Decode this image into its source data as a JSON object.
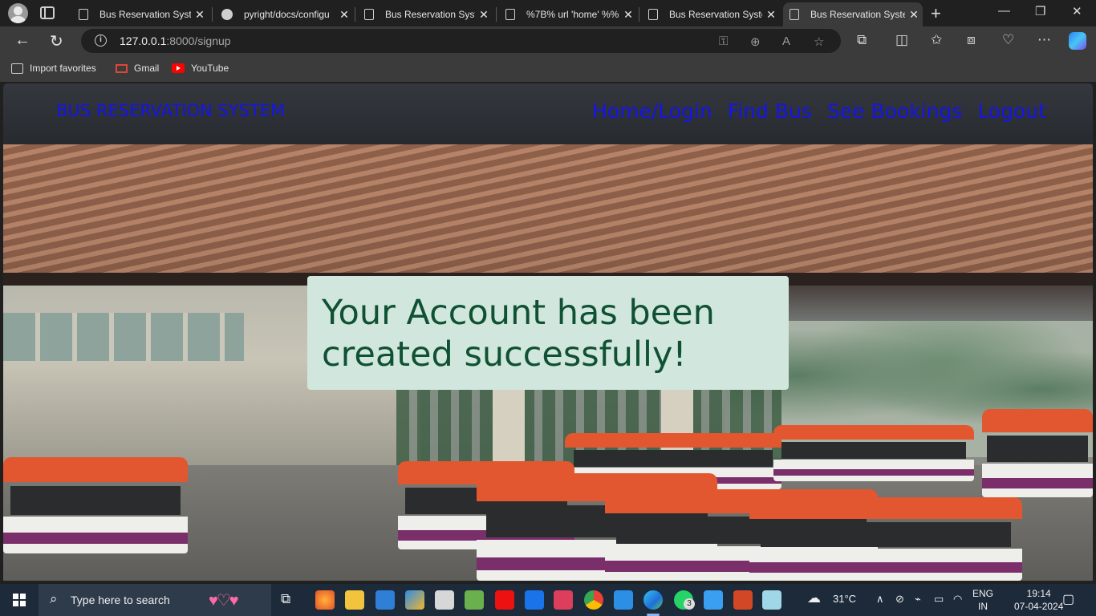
{
  "browser": {
    "tabs": [
      {
        "title": "Bus Reservation Syste",
        "active": false
      },
      {
        "title": "pyright/docs/configu",
        "active": false
      },
      {
        "title": "Bus Reservation Syste",
        "active": false
      },
      {
        "title": "%7B% url 'home' %%",
        "active": false
      },
      {
        "title": "Bus Reservation Syste",
        "active": false
      },
      {
        "title": "Bus Reservation Syste",
        "active": true
      }
    ],
    "close_glyph": "✕",
    "new_tab_glyph": "+",
    "address": {
      "host": "127.0.0.1",
      "rest": ":8000/signup"
    },
    "favorites": [
      {
        "label": "Import favorites",
        "icon": "import-icon"
      },
      {
        "label": "Gmail",
        "icon": "gmail-icon"
      },
      {
        "label": "YouTube",
        "icon": "youtube-icon"
      }
    ]
  },
  "site": {
    "brand": "BUS RESERVATION SYSTEM",
    "nav": [
      "Home/Login",
      "Find Bus",
      "See Bookings",
      "Logout"
    ],
    "alert": "Your Account has been created successfully!",
    "colors": {
      "nav_link": "#1515e8",
      "alert_bg": "#d1e7dd",
      "alert_text": "#0f5132"
    }
  },
  "taskbar": {
    "search_placeholder": "Type here to search",
    "weather": "31°C",
    "lang_top": "ENG",
    "lang_bottom": "IN",
    "time": "19:14",
    "date": "07-04-2024",
    "whatsapp_badge": "3"
  }
}
